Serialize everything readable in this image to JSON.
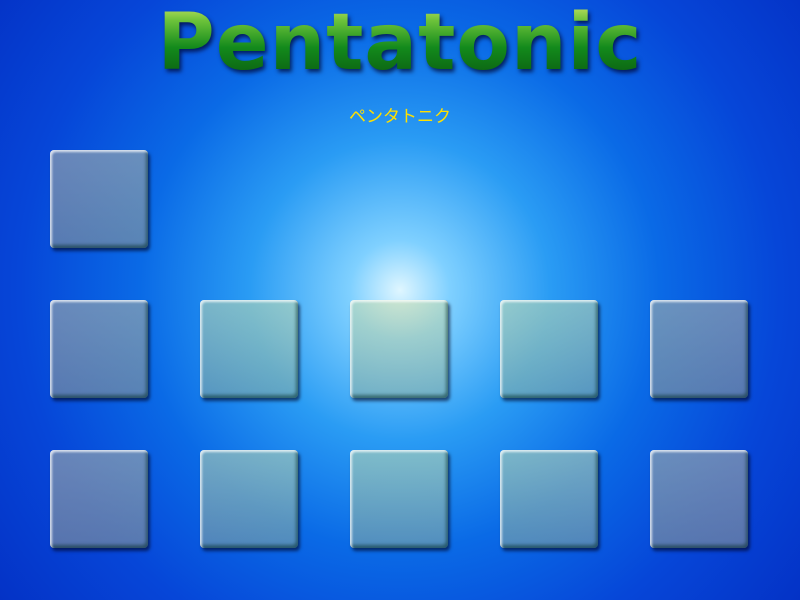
{
  "game": {
    "title": "Pentatonic",
    "subtitle": "ペンタトニク",
    "colors": {
      "title": "#1f8f1f",
      "subtitle": "#ffe000",
      "background": "#0646d8"
    },
    "board": {
      "rows": [
        {
          "tiles": 1
        },
        {
          "tiles": 5
        },
        {
          "tiles": 5
        }
      ]
    }
  }
}
